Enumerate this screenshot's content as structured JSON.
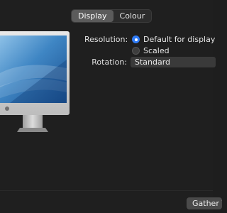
{
  "tabs": [
    {
      "label": "Display",
      "active": true
    },
    {
      "label": "Colour",
      "active": false
    }
  ],
  "resolution": {
    "label": "Resolution:",
    "options": [
      {
        "label": "Default for display",
        "selected": true
      },
      {
        "label": "Scaled",
        "selected": false
      }
    ]
  },
  "rotation": {
    "label": "Rotation:",
    "value": "Standard"
  },
  "footer": {
    "gather_label": "Gather Windows"
  },
  "colors": {
    "accent": "#2f7bf6",
    "background": "#1f1f1f"
  },
  "icons": {
    "monitor": "monitor-icon",
    "apple_logo": "apple-logo-icon"
  }
}
